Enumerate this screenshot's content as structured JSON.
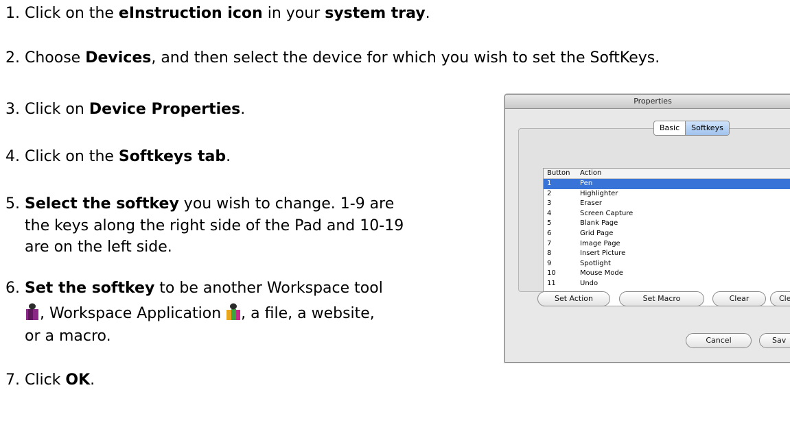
{
  "steps": [
    {
      "num": "1.",
      "pre": "Click on the ",
      "b1": "eInstruction icon",
      "mid": " in your ",
      "b2": "system tray",
      "post": "."
    },
    {
      "num": "2.",
      "pre": "Choose ",
      "b1": "Devices",
      "post": ", and then select the device for which you wish to set the SoftKeys."
    },
    {
      "num": "3.",
      "pre": "Click on ",
      "b1": "Device Properties",
      "post": "."
    },
    {
      "num": "4.",
      "pre": "Click on the ",
      "b1": "Softkeys tab",
      "post": "."
    },
    {
      "num": "5.",
      "b1": "Select the softkey",
      "post": " you wish to change. 1-9 are",
      "line2": "the keys along the right side of the Pad and 10-19",
      "line3": "are on the left side."
    },
    {
      "num": "6.",
      "b1": "Set the softkey",
      "post": " to be another Workspace tool",
      "line2a": ", Workspace Application ",
      "line2b": ", a file, a website,",
      "line3": "or a macro."
    },
    {
      "num": "7.",
      "pre": "Click ",
      "b1": "OK",
      "post": "."
    }
  ],
  "icons": {
    "tool": "workspace-tool-icon",
    "app": "workspace-application-icon"
  },
  "dialog": {
    "title": "Properties",
    "tabs": [
      "Basic",
      "Softkeys"
    ],
    "selected_tab": "Softkeys",
    "headers": {
      "button": "Button",
      "action": "Action"
    },
    "rows": [
      {
        "button": "1",
        "action": "Pen"
      },
      {
        "button": "2",
        "action": "Highlighter"
      },
      {
        "button": "3",
        "action": "Eraser"
      },
      {
        "button": "4",
        "action": "Screen Capture"
      },
      {
        "button": "5",
        "action": "Blank Page"
      },
      {
        "button": "6",
        "action": "Grid Page"
      },
      {
        "button": "7",
        "action": "Image Page"
      },
      {
        "button": "8",
        "action": "Insert Picture"
      },
      {
        "button": "9",
        "action": "Spotlight"
      },
      {
        "button": "10",
        "action": "Mouse Mode"
      },
      {
        "button": "11",
        "action": "Undo"
      }
    ],
    "selected_row": "1",
    "buttons": {
      "set_action": "Set Action",
      "set_macro": "Set Macro",
      "clear": "Clear",
      "clear_all": "Clear A",
      "cancel": "Cancel",
      "save": "Sav"
    }
  }
}
